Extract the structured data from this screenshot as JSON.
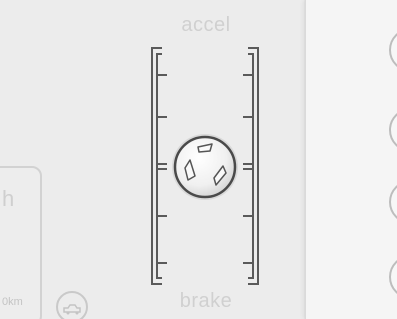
{
  "pedal_control": {
    "accel_label": "accel",
    "brake_label": "brake"
  },
  "info_card": {
    "partial_letter": "h",
    "odometer_partial": "0km"
  },
  "icons": {
    "engine": "engine-warning-icon",
    "knob": "joystick-knob-icon"
  },
  "colors": {
    "background": "#ececec",
    "rail": "#555555",
    "label": "#d0d0d0"
  }
}
